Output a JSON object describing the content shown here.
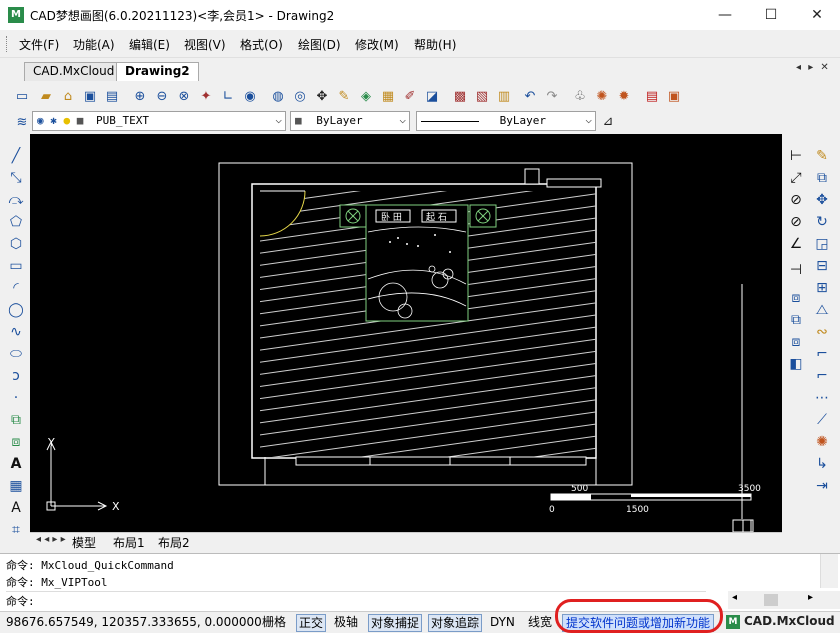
{
  "window": {
    "title": "CAD梦想画图(6.0.20211123)<李,会员1> - Drawing2",
    "icon_label": "M",
    "minimize": "—",
    "maximize": "☐",
    "close": "✕"
  },
  "menu": [
    "文件(F)",
    "功能(A)",
    "编辑(E)",
    "视图(V)",
    "格式(O)",
    "绘图(D)",
    "修改(M)",
    "帮助(H)"
  ],
  "doc_tabs": [
    {
      "label": "CAD.MxCloud",
      "active": false
    },
    {
      "label": "Drawing2",
      "active": true
    }
  ],
  "tab_nav": "◂ ▸ ✕",
  "properties": {
    "layer": "PUB_TEXT",
    "color": "ByLayer",
    "linetype": "ByLayer"
  },
  "drawing": {
    "room_labels": [
      "卧 田",
      "起 石"
    ],
    "scale_labels": [
      "500",
      "3500",
      "0",
      "1500"
    ],
    "ucs_y": "Y",
    "ucs_x": "X"
  },
  "layout_tabs": [
    "模型",
    "布局1",
    "布局2"
  ],
  "command": {
    "lines": [
      "命令: MxCloud_QuickCommand",
      "命令: Mx_VIPTool",
      "命令:"
    ]
  },
  "status": {
    "coords": "98676.657549, 120357.333655, 0.000000",
    "toggles": [
      {
        "label": "栅格",
        "on": false
      },
      {
        "label": "正交",
        "on": true
      },
      {
        "label": "极轴",
        "on": false
      },
      {
        "label": "对象捕捉",
        "on": true
      },
      {
        "label": "对象追踪",
        "on": true
      },
      {
        "label": "DYN",
        "on": false
      },
      {
        "label": "线宽",
        "on": false
      }
    ],
    "feedback": "提交软件问题或增加新功能",
    "brand": "CAD.MxCloud"
  },
  "colors": {
    "canvas": "#000000",
    "drawing_lines": "#ffffff",
    "furniture": "#7fd17f",
    "door_arc": "#e6d84a",
    "highlight_ring": "#e02020"
  }
}
